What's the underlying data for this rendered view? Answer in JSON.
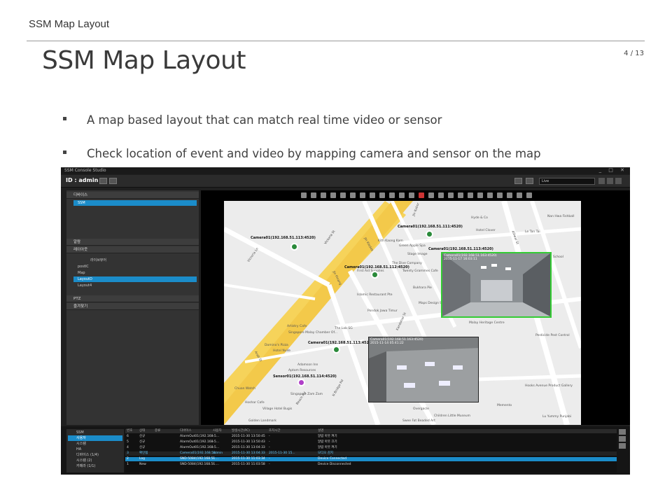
{
  "slide": {
    "header": "SSM Map Layout",
    "title": "SSM Map Layout",
    "page": "4 / 13",
    "bullets": [
      "A map based layout that can match real time video or sensor",
      "Check location of event and video by mapping camera and sensor on the map"
    ]
  },
  "app": {
    "window_title": "SSM Console Studio",
    "user_id": "ID : admin",
    "live_select": "Live",
    "left_panel": {
      "devices_header": "디바이스",
      "device_root": "SSM",
      "alarm_header": "알람",
      "layout_header": "레이아웃",
      "layout_nav": "라이브뷰어",
      "layout_items": [
        "postIC",
        "Map",
        "LayoutD",
        "Layout4"
      ],
      "selected_layout": "LayoutD",
      "ptz_header": "PTZ",
      "favorites_header": "즐겨찾기"
    },
    "map": {
      "street_labels": [
        "Victoria St",
        "Jln Kledek",
        "Jln Pinang",
        "Kandahar St",
        "Arab St",
        "Beach Rd",
        "N Bridge Rd",
        "Jln Kubor",
        "Alliwal St",
        "Victoria Ln"
      ],
      "places": [
        "Hyde & Co",
        "Nan Hwa Fishball",
        "Hotel Clover",
        "Le Tan Tai",
        "Kith Kaong Kam",
        "Green Apple Spa",
        "Stage Image",
        "First Aid Supplies",
        "The Dive Company",
        "Twenty Grammes Cafe",
        "Bukhara Pie",
        "Islamic Restaurant Pte",
        "Pondok Jawa Timur",
        "Maps Design Studio",
        "Malay Heritage Centre",
        "The Lab SG",
        "Artistry Cafe",
        "Singapore Malay Chamber Of...",
        "Domino's Pizza",
        "Hotel NuVe",
        "Adamson Inn",
        "Aptom Resources",
        "Chuan Watch",
        "Hoshar Cafe",
        "Singapore Zam Zam",
        "Village Hotel Bugis",
        "Golden Landmark",
        "Pesticide Pest Control",
        "Hooks Avenue Product Gallery",
        "Children Little Museum",
        "Memento",
        "Overgacle",
        "Swee Fat Beaded Art",
        "School",
        "Lu Yummy Punjabi"
      ],
      "cameras": [
        {
          "label": "Camera01(192.168.51.113:4520)",
          "color": "#2a8a3a"
        },
        {
          "label": "Camera01(192.168.51.111:4520)",
          "color": "#2a8a3a"
        },
        {
          "label": "Camera01(192.168.51.112:4520)",
          "color": "#2a8a3a"
        },
        {
          "label": "Camera01(192.168.51.113:4520)",
          "color": "#2a8a3a"
        },
        {
          "label": "Camera01(192.168.51.113:4520)",
          "color": "#2a8a3a"
        },
        {
          "label": "Sensor01(192.168.51.114:4520)",
          "color": "#b03fc8"
        }
      ],
      "video1_caption": "Camera01(192.168.51.163:4520)\n2015-11-17 16:03:11",
      "video2_caption": "Camera01(192.168.51.163:4520)\n2015-11-14 05:41:22"
    },
    "bottom": {
      "tree": [
        {
          "label": "SSM",
          "sel": false
        },
        {
          "label": "사용자",
          "sel": true
        },
        {
          "label": "시스템",
          "sel": false
        },
        {
          "label": "HA",
          "sel": false
        },
        {
          "label": "디바이스 (1/4)",
          "sel": false
        },
        {
          "label": "시스템 (2)",
          "sel": false
        },
        {
          "label": "카메라 (1/1)",
          "sel": false
        }
      ],
      "table_headers": [
        "번호",
        "상태",
        "종류",
        "디바이스",
        "사용자",
        "발생시간(PC)",
        "조치시간",
        "설명"
      ],
      "rows": [
        {
          "cells": [
            "6",
            "신규",
            "",
            "AlarmOut01(192.168.5...",
            "-",
            "2015-11-30 13:50:45",
            "-",
            "알람 아웃 켜기"
          ],
          "style": ""
        },
        {
          "cells": [
            "5",
            "신규",
            "",
            "AlarmOut01(192.168.5...",
            "-",
            "2015-11-30 13:50:43",
            "-",
            "알람 아웃 끄기"
          ],
          "style": ""
        },
        {
          "cells": [
            "4",
            "신규",
            "",
            "AlarmOut01(192.168.5...",
            "-",
            "2015-11-30 13:04:33",
            "-",
            "알람 아웃 켜기"
          ],
          "style": ""
        },
        {
          "cells": [
            "3",
            "확인됨",
            "",
            "Camera01(192.168.51...",
            "admin",
            "2015-11-30 13:04:33",
            "2015-11-30 15...",
            "모디오 감지"
          ],
          "style": "hl"
        },
        {
          "cells": [
            "2",
            "Log",
            "",
            "SND-5084(192.168.51....",
            "-",
            "2015-11-30 11:03:34",
            "-",
            "Device Connected"
          ],
          "style": "sel"
        },
        {
          "cells": [
            "1",
            "New",
            "",
            "SND-5084(192.168.51....",
            "-",
            "2015-11-30 11:03:58",
            "-",
            "Device Disconnected"
          ],
          "style": ""
        }
      ]
    }
  },
  "colors": {
    "accent": "#1b8cc9",
    "map_road_yellow": "#f6d35a",
    "camera_green": "#2a8a3a",
    "sensor_purple": "#b03fc8"
  }
}
